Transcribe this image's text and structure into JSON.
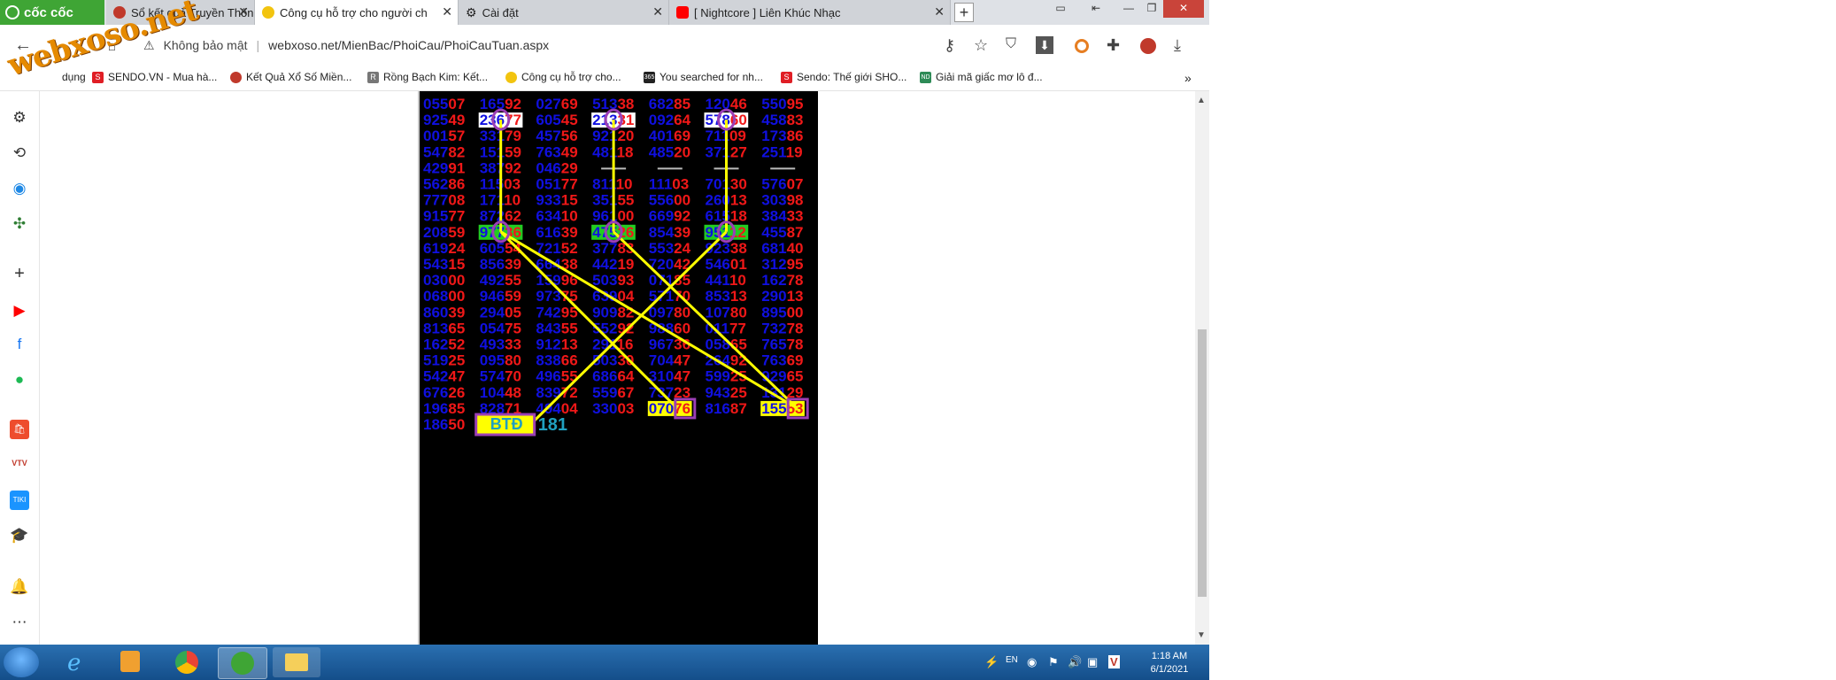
{
  "browser": {
    "brand_label": "cốc cốc",
    "tabs": [
      {
        "label": "Sổ kết quả Truyền Thống - T",
        "active": false
      },
      {
        "label": "Công cụ hỗ trợ cho người ch",
        "active": true
      },
      {
        "label": "Cài đặt",
        "active": false
      },
      {
        "label": "[ Nightcore ] Liên Khúc Nhạc",
        "active": false
      }
    ],
    "new_tab_label": "+",
    "security_label": "Không bảo mật",
    "url": "webxoso.net/MienBac/PhoiCau/PhoiCauTuan.aspx",
    "bookmarks": [
      {
        "label": "dụng"
      },
      {
        "label": "SENDO.VN - Mua hà..."
      },
      {
        "label": "Kết Quả Xổ Số Miền..."
      },
      {
        "label": "Rồng Bạch Kim: Kết..."
      },
      {
        "label": "Công cụ hỗ trợ cho..."
      },
      {
        "label": "You searched for nh..."
      },
      {
        "label": "Sendo: Thế giới SHO..."
      },
      {
        "label": "Giải mã giấc mơ lô đ..."
      }
    ],
    "bookmarks_overflow": "»",
    "watermark": "webxoso.net"
  },
  "board": {
    "rows": [
      [
        "05507",
        "16592",
        "02769",
        "51338",
        "68285",
        "12046",
        "55095"
      ],
      [
        "92549",
        "23677",
        "60545",
        "21331",
        "09264",
        "57860",
        "45883"
      ],
      [
        "00157",
        "33179",
        "45756",
        "92120",
        "40169",
        "71109",
        "17386"
      ],
      [
        "54782",
        "15159",
        "76349",
        "48118",
        "48520",
        "37127",
        "25119"
      ],
      [
        "42991",
        "38792",
        "04629",
        "",
        "",
        "",
        ""
      ],
      [
        "56286",
        "11503",
        "05177",
        "81110",
        "11103",
        "70130",
        "57607"
      ],
      [
        "77708",
        "17110",
        "93315",
        "35155",
        "55600",
        "26013",
        "30398"
      ],
      [
        "91577",
        "87262",
        "63410",
        "96100",
        "66992",
        "61518",
        "38433"
      ],
      [
        "20859",
        "97736",
        "61639",
        "47526",
        "85439",
        "95112",
        "45587"
      ],
      [
        "61924",
        "60554",
        "72152",
        "37783",
        "55324",
        "92338",
        "68140"
      ],
      [
        "54315",
        "85639",
        "66438",
        "44219",
        "72042",
        "54601",
        "31295"
      ],
      [
        "03000",
        "49255",
        "15996",
        "50393",
        "07185",
        "44110",
        "16278"
      ],
      [
        "06800",
        "94659",
        "97375",
        "63904",
        "57170",
        "85313",
        "29013"
      ],
      [
        "86039",
        "29405",
        "74295",
        "90982",
        "09780",
        "10780",
        "89500"
      ],
      [
        "81365",
        "05475",
        "84355",
        "55292",
        "98860",
        "01177",
        "73278"
      ],
      [
        "16252",
        "49333",
        "91213",
        "29116",
        "96736",
        "05865",
        "76578"
      ],
      [
        "51925",
        "09580",
        "83866",
        "50330",
        "70447",
        "26492",
        "76369"
      ],
      [
        "54247",
        "57470",
        "49655",
        "68664",
        "31047",
        "59925",
        "92965"
      ],
      [
        "67626",
        "10448",
        "83972",
        "55967",
        "73723",
        "94325",
        "13129"
      ],
      [
        "19685",
        "82871",
        "49404",
        "33003",
        "07076",
        "81687",
        "15553"
      ],
      [
        "18650",
        "",
        "",
        "",
        "",
        "",
        ""
      ]
    ],
    "highlights": [
      {
        "row": 1,
        "col": 1,
        "style": "white"
      },
      {
        "row": 1,
        "col": 3,
        "style": "white"
      },
      {
        "row": 1,
        "col": 5,
        "style": "white"
      },
      {
        "row": 8,
        "col": 1,
        "style": "green"
      },
      {
        "row": 8,
        "col": 3,
        "style": "green"
      },
      {
        "row": 8,
        "col": 5,
        "style": "green"
      },
      {
        "row": 19,
        "col": 4,
        "style": "yellow"
      },
      {
        "row": 19,
        "col": 6,
        "style": "yellow"
      }
    ],
    "btd_label": "BTĐ",
    "btd_value": "181",
    "colors": {
      "blue": "#1010e0",
      "red": "#f01818",
      "line": "#ffff00",
      "circle": "#9b3fb5"
    }
  },
  "taskbar": {
    "time": "1:18 AM",
    "date": "6/1/2021"
  }
}
